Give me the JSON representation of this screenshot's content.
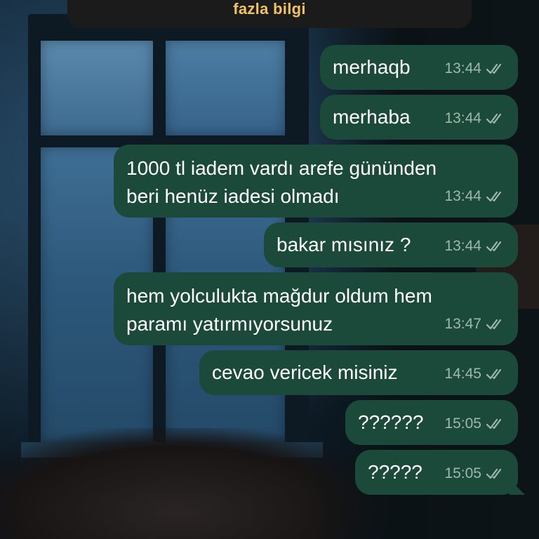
{
  "header": {
    "banner_text": "fazla bilgi",
    "banner_color": "#f0c165"
  },
  "theme": {
    "bubble_color": "#1c4a3a",
    "meta_color": "#9fb8ad",
    "text_color": "#ffffff"
  },
  "messages": [
    {
      "lines": [
        "merhaqb"
      ],
      "time": "13:44",
      "status": "read-check-icon"
    },
    {
      "lines": [
        "merhaba"
      ],
      "time": "13:44",
      "status": "read-check-icon"
    },
    {
      "lines": [
        "1000 tl iadem vardı arefe gününden",
        "beri henüz iadesi olmadı"
      ],
      "time": "13:44",
      "status": "read-check-icon"
    },
    {
      "lines": [
        "bakar mısınız ?"
      ],
      "time": "13:44",
      "status": "read-check-icon"
    },
    {
      "lines": [
        "hem yolculukta mağdur oldum hem",
        "paramı yatırmıyorsunuz"
      ],
      "time": "13:47",
      "status": "read-check-icon"
    },
    {
      "lines": [
        "cevao vericek misiniz"
      ],
      "time": "14:45",
      "status": "read-check-icon"
    },
    {
      "lines": [
        "??????"
      ],
      "time": "15:05",
      "status": "read-check-icon"
    },
    {
      "lines": [
        "?????"
      ],
      "time": "15:05",
      "status": "read-check-icon"
    }
  ]
}
